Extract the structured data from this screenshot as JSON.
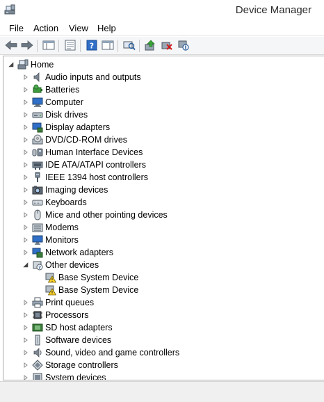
{
  "window": {
    "title": "Device Manager"
  },
  "menu": [
    {
      "name": "menu-file",
      "label": "File"
    },
    {
      "name": "menu-action",
      "label": "Action"
    },
    {
      "name": "menu-view",
      "label": "View"
    },
    {
      "name": "menu-help",
      "label": "Help"
    }
  ],
  "toolbar": [
    {
      "name": "back-button",
      "icon": "arrow-left-icon"
    },
    {
      "name": "forward-button",
      "icon": "arrow-right-icon"
    },
    {
      "name": "show-hide-console-tree-button",
      "icon": "console-tree-icon"
    },
    {
      "name": "properties-button",
      "icon": "properties-icon"
    },
    {
      "name": "help-button",
      "icon": "help-icon"
    },
    {
      "name": "show-action-pane-button",
      "icon": "action-pane-icon"
    },
    {
      "name": "scan-hardware-button",
      "icon": "scan-hardware-icon"
    },
    {
      "name": "update-driver-button",
      "icon": "update-driver-icon"
    },
    {
      "name": "uninstall-button",
      "icon": "uninstall-icon"
    },
    {
      "name": "disable-button",
      "icon": "disable-icon"
    }
  ],
  "tree": {
    "root": {
      "label": "Home",
      "icon": "computer-root-icon",
      "expanded": true
    },
    "items": [
      {
        "label": "Audio inputs and outputs",
        "icon": "speaker-icon",
        "expanded": false
      },
      {
        "label": "Batteries",
        "icon": "battery-icon",
        "expanded": false
      },
      {
        "label": "Computer",
        "icon": "computer-icon",
        "expanded": false
      },
      {
        "label": "Disk drives",
        "icon": "disk-drive-icon",
        "expanded": false
      },
      {
        "label": "Display adapters",
        "icon": "display-adapter-icon",
        "expanded": false
      },
      {
        "label": "DVD/CD-ROM drives",
        "icon": "dvd-drive-icon",
        "expanded": false
      },
      {
        "label": "Human Interface Devices",
        "icon": "hid-icon",
        "expanded": false
      },
      {
        "label": "IDE ATA/ATAPI controllers",
        "icon": "ide-controller-icon",
        "expanded": false
      },
      {
        "label": "IEEE 1394 host controllers",
        "icon": "ieee1394-icon",
        "expanded": false
      },
      {
        "label": "Imaging devices",
        "icon": "camera-icon",
        "expanded": false
      },
      {
        "label": "Keyboards",
        "icon": "keyboard-icon",
        "expanded": false
      },
      {
        "label": "Mice and other pointing devices",
        "icon": "mouse-icon",
        "expanded": false
      },
      {
        "label": "Modems",
        "icon": "modem-icon",
        "expanded": false
      },
      {
        "label": "Monitors",
        "icon": "monitor-icon",
        "expanded": false
      },
      {
        "label": "Network adapters",
        "icon": "network-adapter-icon",
        "expanded": false
      },
      {
        "label": "Other devices",
        "icon": "unknown-device-icon",
        "expanded": true,
        "children": [
          {
            "label": "Base System Device",
            "icon": "warning-device-icon"
          },
          {
            "label": "Base System Device",
            "icon": "warning-device-icon"
          }
        ]
      },
      {
        "label": "Print queues",
        "icon": "printer-icon",
        "expanded": false
      },
      {
        "label": "Processors",
        "icon": "processor-icon",
        "expanded": false
      },
      {
        "label": "SD host adapters",
        "icon": "sd-adapter-icon",
        "expanded": false
      },
      {
        "label": "Software devices",
        "icon": "software-device-icon",
        "expanded": false
      },
      {
        "label": "Sound, video and game controllers",
        "icon": "sound-controller-icon",
        "expanded": false
      },
      {
        "label": "Storage controllers",
        "icon": "storage-controller-icon",
        "expanded": false
      },
      {
        "label": "System devices",
        "icon": "system-device-icon",
        "expanded": false
      }
    ]
  }
}
